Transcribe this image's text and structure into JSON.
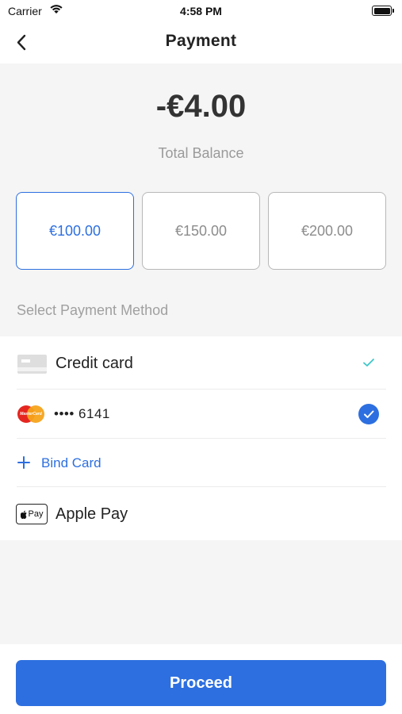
{
  "status_bar": {
    "carrier": "Carrier",
    "time": "4:58 PM"
  },
  "header": {
    "title": "Payment"
  },
  "balance": {
    "amount": "-€4.00",
    "label": "Total Balance"
  },
  "amount_options": [
    {
      "label": "€100.00",
      "selected": true
    },
    {
      "label": "€150.00",
      "selected": false
    },
    {
      "label": "€200.00",
      "selected": false
    }
  ],
  "payment_methods": {
    "section_label": "Select Payment Method",
    "credit_card": {
      "label": "Credit card",
      "icon": "credit-card-icon"
    },
    "saved_card": {
      "card_brand_logo": "MasterCard",
      "masked_number": "•••• 6141",
      "icon": "mastercard-icon",
      "selected": true
    },
    "bind_card": {
      "label": "Bind Card",
      "icon": "plus-icon"
    },
    "apple_pay": {
      "label": "Apple Pay",
      "badge": "Pay",
      "icon": "apple-pay-icon"
    }
  },
  "footer": {
    "proceed_label": "Proceed"
  },
  "colors": {
    "accent": "#2d6fe0",
    "teal_check": "#3ec6c8",
    "background": "#f5f5f5"
  }
}
